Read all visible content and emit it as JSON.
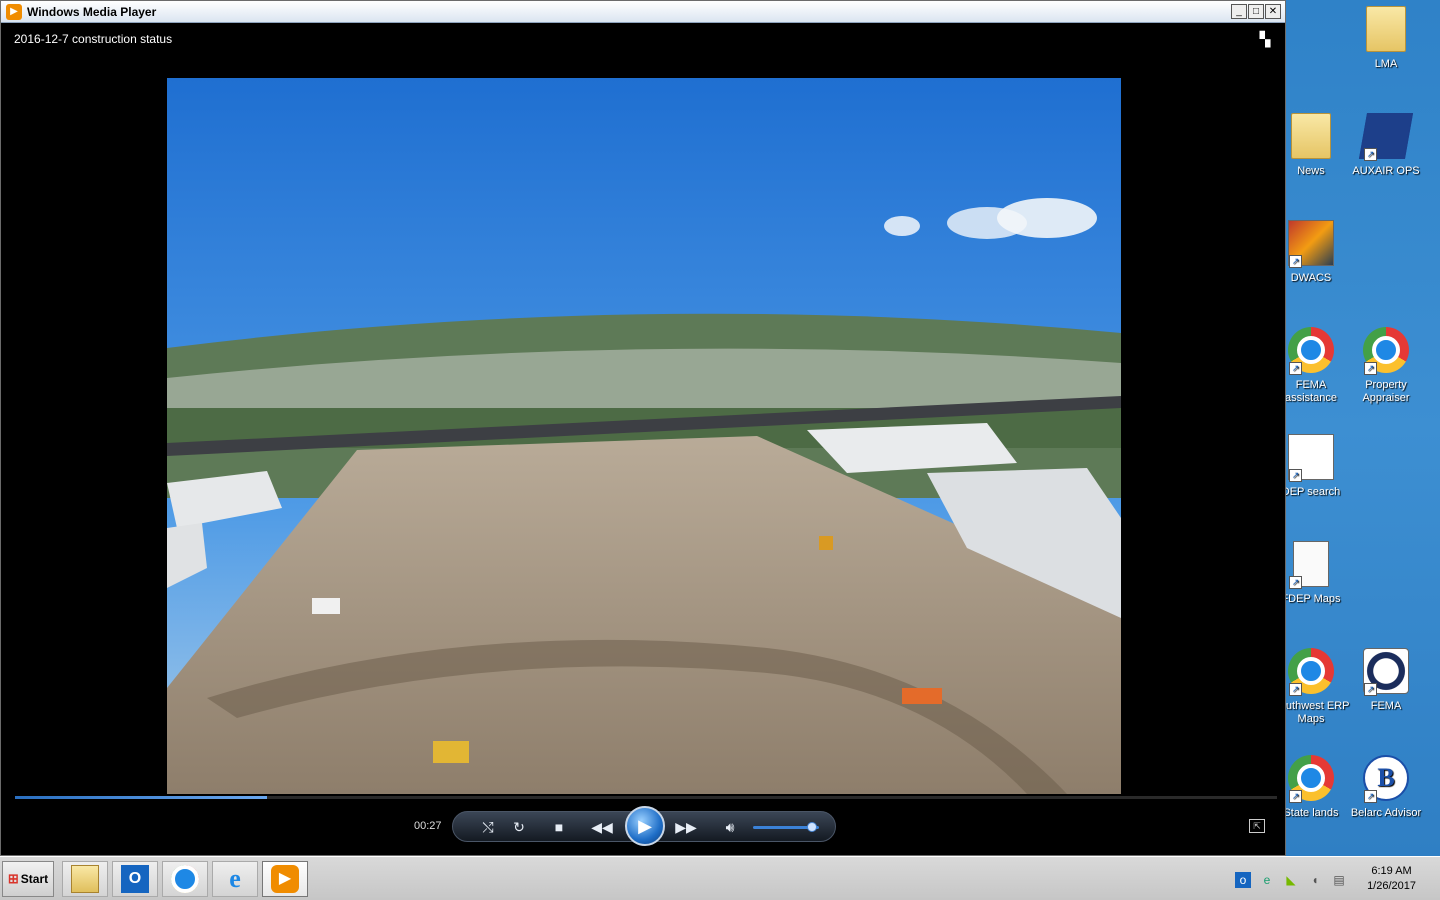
{
  "window": {
    "title": "Windows Media Player",
    "minimize": "_",
    "maximize": "□",
    "close": "✕"
  },
  "player": {
    "media_title": "2016-12-7 construction status",
    "time": "00:27",
    "seek_progress": 0.2,
    "volume_level": 0.9
  },
  "controls": {
    "shuffle_icon": "shuffle-icon",
    "repeat_icon": "repeat-icon",
    "stop_icon": "stop-icon",
    "previous_icon": "previous-icon",
    "play_icon": "play-icon",
    "next_icon": "next-icon",
    "volume_icon": "volume-icon"
  },
  "desktop": {
    "icons": [
      {
        "label": "LMA",
        "kind": "folder"
      },
      {
        "label": "News",
        "kind": "folder"
      },
      {
        "label": "AUXAIR OPS",
        "kind": "badge"
      },
      {
        "label": "DWACS",
        "kind": "app"
      },
      {
        "label": "FEMA assistance",
        "kind": "chrome"
      },
      {
        "label": "Property Appraiser",
        "kind": "chrome"
      },
      {
        "label": "DEP search",
        "kind": "app"
      },
      {
        "label": "FDEP Maps",
        "kind": "file"
      },
      {
        "label": "Southwest ERP Maps",
        "kind": "chrome"
      },
      {
        "label": "FEMA",
        "kind": "seal"
      },
      {
        "label": "State lands",
        "kind": "chrome"
      },
      {
        "label": "Belarc Advisor",
        "kind": "app"
      }
    ]
  },
  "taskbar": {
    "start_label": "Start",
    "items": [
      {
        "name": "file-explorer",
        "icon": "folder-icon"
      },
      {
        "name": "outlook",
        "icon": "outlook-icon"
      },
      {
        "name": "chrome",
        "icon": "chrome-icon"
      },
      {
        "name": "internet-explorer",
        "icon": "ie-icon"
      },
      {
        "name": "windows-media-player",
        "icon": "wmp-icon"
      }
    ],
    "clock_time": "6:19 AM",
    "clock_date": "1/26/2017"
  },
  "colors": {
    "accent": "#3b82d8",
    "desktop": "#3a8ccf",
    "window_bg": "#000000"
  }
}
